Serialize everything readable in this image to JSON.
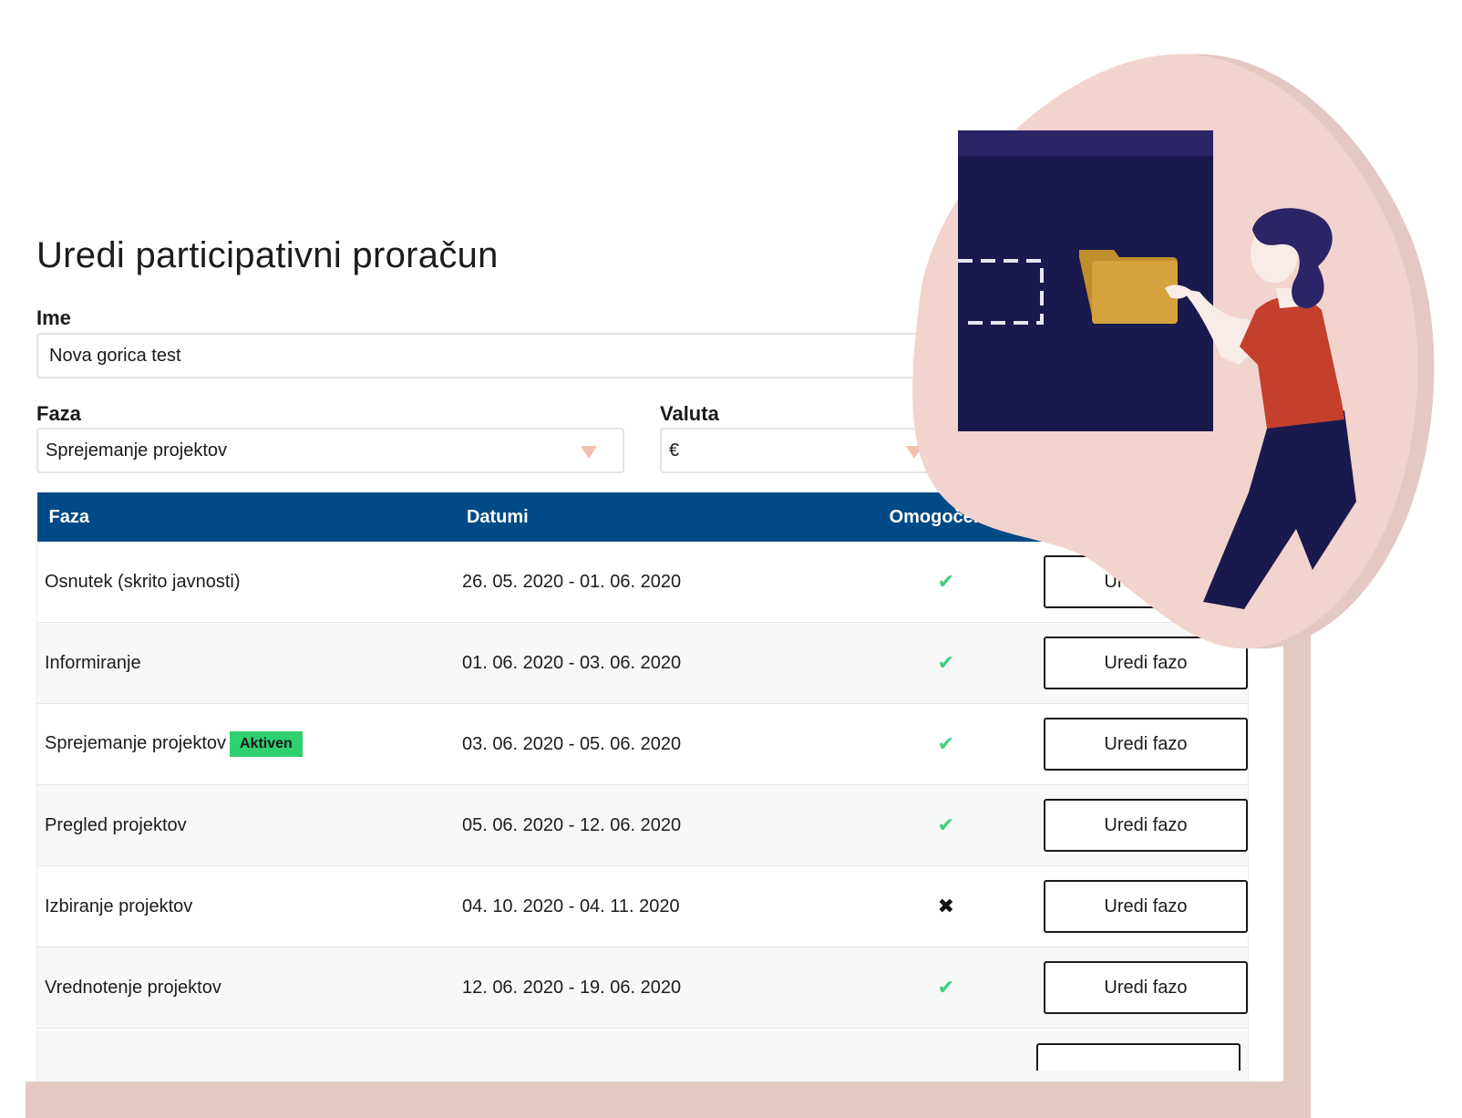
{
  "page": {
    "title": "Uredi participativni proračun"
  },
  "form": {
    "name_label": "Ime",
    "name_value": "Nova gorica test",
    "phase_label": "Faza",
    "phase_value": "Sprejemanje projektov",
    "currency_label": "Valuta",
    "currency_value": "€"
  },
  "table": {
    "headers": {
      "phase": "Faza",
      "dates": "Datumi",
      "enabled": "Omogočeno",
      "action": ""
    },
    "rows": [
      {
        "name": "Osnutek (skrito javnosti)",
        "dates": "26. 05. 2020 - 01. 06. 2020",
        "enabled": "✔",
        "enabled_state": true,
        "badge": "",
        "action": "Uredi fazo"
      },
      {
        "name": "Informiranje",
        "dates": "01. 06. 2020 - 03. 06. 2020",
        "enabled": "✔",
        "enabled_state": true,
        "badge": "",
        "action": "Uredi fazo"
      },
      {
        "name": "Sprejemanje projektov",
        "dates": "03. 06. 2020 - 05. 06. 2020",
        "enabled": "✔",
        "enabled_state": true,
        "badge": "Aktiven",
        "action": "Uredi fazo"
      },
      {
        "name": "Pregled projektov",
        "dates": "05. 06. 2020 - 12. 06. 2020",
        "enabled": "✔",
        "enabled_state": true,
        "badge": "",
        "action": "Uredi fazo"
      },
      {
        "name": "Izbiranje projektov",
        "dates": "04. 10. 2020 - 04. 11. 2020",
        "enabled": "✖",
        "enabled_state": false,
        "badge": "",
        "action": "Uredi fazo"
      },
      {
        "name": "Vrednotenje projektov",
        "dates": "12. 06. 2020 - 19. 06. 2020",
        "enabled": "✔",
        "enabled_state": true,
        "badge": "",
        "action": "Uredi fazo"
      }
    ]
  },
  "colors": {
    "header_bg": "#004a85",
    "check": "#3ecf7e",
    "badge_bg": "#2fd06f",
    "blob": "#f2d3ce",
    "frame": "#e4c8c3",
    "panel": "#19194d",
    "shirt": "#c4402c",
    "folder": "#d6a23e"
  },
  "icons": {
    "select_arrow": "chevron-down-icon",
    "enabled": "check-icon",
    "disabled": "cross-icon"
  }
}
